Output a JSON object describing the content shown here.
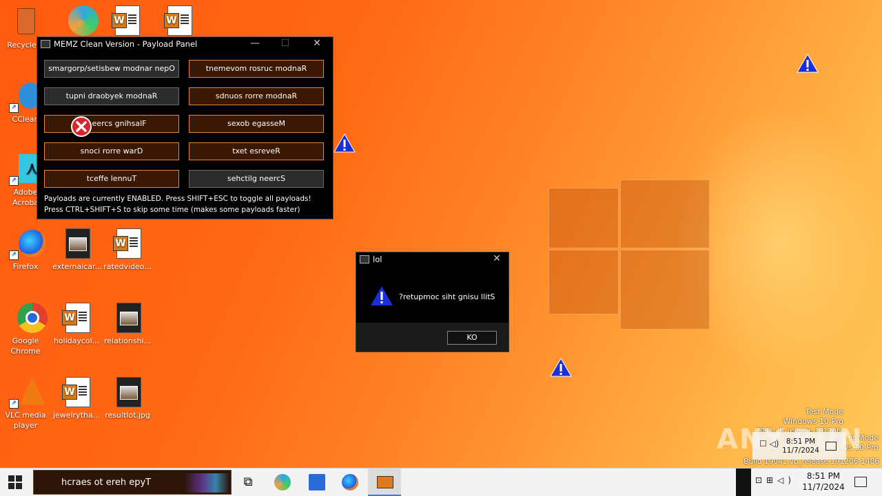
{
  "desktop": {
    "icons": [
      {
        "label": "Recycle Bin",
        "label_visible": "Recycle B"
      },
      {
        "label": "CCleaner",
        "label_visible": "CClean"
      },
      {
        "label": "Adobe Acrobat",
        "label_visible": "Adobe Acroba"
      },
      {
        "label": "Firefox"
      },
      {
        "label": "externalcar..."
      },
      {
        "label": "ratedvideo..."
      },
      {
        "label": "Google Chrome"
      },
      {
        "label": "holidaycol..."
      },
      {
        "label": "relationshi..."
      },
      {
        "label": "VLC media player"
      },
      {
        "label": "jewelrytha..."
      },
      {
        "label": "resultlot.jpg"
      }
    ]
  },
  "payload_panel": {
    "title": "MEMZ Clean Version - Payload Panel",
    "buttons": [
      {
        "label": "smargorp/setisbew modnar nepO",
        "state": "off"
      },
      {
        "label": "tnemevom rosruc modnaR",
        "state": "on"
      },
      {
        "label": "tupni draobyek modnaR",
        "state": "off"
      },
      {
        "label": "sdnuos rorre modnaR",
        "state": "on"
      },
      {
        "label": "neercs gnihsalF",
        "label_visible": "eercs gnihsalF",
        "state": "on"
      },
      {
        "label": "sexob egasseM",
        "state": "on"
      },
      {
        "label": "snoci rorre warD",
        "state": "on"
      },
      {
        "label": "txet esreveR",
        "state": "on"
      },
      {
        "label": "tceffe lennuT",
        "state": "on"
      },
      {
        "label": "sehctilg neercS",
        "state": "off"
      }
    ],
    "status_line1": "Payloads are currently ENABLED. Press SHIFT+ESC to toggle all payloads!",
    "status_line2": "Press CTRL+SHIFT+S to skip some time (makes some payloads faster)"
  },
  "dialog": {
    "title": "lol",
    "message": "?retupmoc siht gnisu llitS",
    "button": "KO"
  },
  "taskbar": {
    "search_placeholder": "hcraes ot ereh epyT",
    "time": "8:51 PM",
    "date": "11/7/2024"
  },
  "overlay": {
    "mode_line1": "Test Mode",
    "mode_line2": "Windows 10 Pro",
    "mode_line3": "Build 19041.vb_release.191206-1406",
    "mode_line3_ghost": "2041.vb_release.191206-1406",
    "ghost_line1": "st Mode",
    "ghost_line2": "ws 10 Pro",
    "ghost_time": "8:51 PM",
    "ghost_date": "11/7/2024",
    "watermark": "ANY.RUN"
  },
  "colors": {
    "btn_on_bg": "#3a1804",
    "btn_on_border": "#e0893a",
    "btn_off_bg": "#2c2c2c",
    "warning_blue": "#1a2fd8"
  }
}
